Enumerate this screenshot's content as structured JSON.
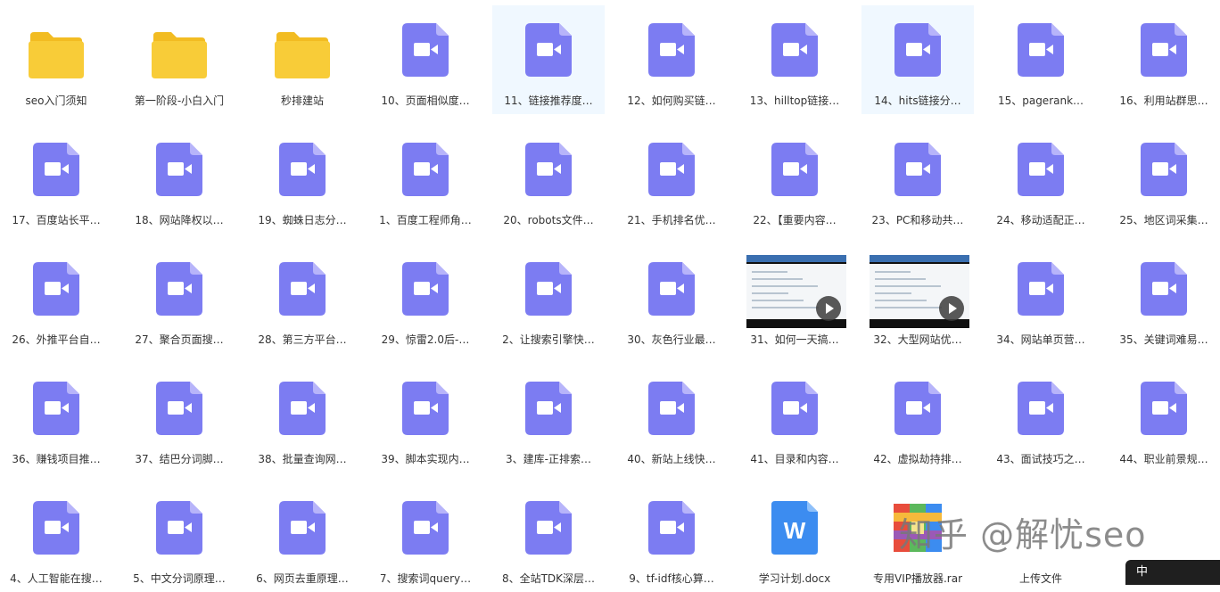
{
  "files": [
    {
      "name": "seo入门须知",
      "type": "folder"
    },
    {
      "name": "第一阶段-小白入门",
      "type": "folder"
    },
    {
      "name": "秒排建站",
      "type": "folder"
    },
    {
      "name": "10、页面相似度…",
      "type": "video"
    },
    {
      "name": "11、链接推荐度…",
      "type": "video",
      "selected": true
    },
    {
      "name": "12、如何购买链…",
      "type": "video"
    },
    {
      "name": "13、hilltop链接…",
      "type": "video"
    },
    {
      "name": "14、hits链接分…",
      "type": "video",
      "selected": true
    },
    {
      "name": "15、pagerank…",
      "type": "video"
    },
    {
      "name": "16、利用站群思…",
      "type": "video"
    },
    {
      "name": "17、百度站长平…",
      "type": "video"
    },
    {
      "name": "18、网站降权以…",
      "type": "video"
    },
    {
      "name": "19、蜘蛛日志分…",
      "type": "video"
    },
    {
      "name": "1、百度工程师角…",
      "type": "video"
    },
    {
      "name": "20、robots文件…",
      "type": "video"
    },
    {
      "name": "21、手机排名优…",
      "type": "video"
    },
    {
      "name": "22、【重要内容…",
      "type": "video"
    },
    {
      "name": "23、PC和移动共…",
      "type": "video"
    },
    {
      "name": "24、移动适配正…",
      "type": "video"
    },
    {
      "name": "25、地区词采集…",
      "type": "video"
    },
    {
      "name": "26、外推平台自…",
      "type": "video"
    },
    {
      "name": "27、聚合页面搜…",
      "type": "video"
    },
    {
      "name": "28、第三方平台…",
      "type": "video"
    },
    {
      "name": "29、惊雷2.0后-…",
      "type": "video"
    },
    {
      "name": "2、让搜索引擎快…",
      "type": "video"
    },
    {
      "name": "30、灰色行业最…",
      "type": "video"
    },
    {
      "name": "31、如何一天搞…",
      "type": "thumb"
    },
    {
      "name": "32、大型网站优…",
      "type": "thumb"
    },
    {
      "name": "34、网站单页营…",
      "type": "video"
    },
    {
      "name": "35、关键词难易…",
      "type": "video"
    },
    {
      "name": "36、赚钱项目推…",
      "type": "video"
    },
    {
      "name": "37、结巴分词脚…",
      "type": "video"
    },
    {
      "name": "38、批量查询网…",
      "type": "video"
    },
    {
      "name": "39、脚本实现内…",
      "type": "video"
    },
    {
      "name": "3、建库-正排索…",
      "type": "video"
    },
    {
      "name": "40、新站上线快…",
      "type": "video"
    },
    {
      "name": "41、目录和内容…",
      "type": "video"
    },
    {
      "name": "42、虚拟劫持排…",
      "type": "video"
    },
    {
      "name": "43、面试技巧之…",
      "type": "video"
    },
    {
      "name": "44、职业前景规…",
      "type": "video"
    },
    {
      "name": "4、人工智能在搜…",
      "type": "video"
    },
    {
      "name": "5、中文分词原理…",
      "type": "video"
    },
    {
      "name": "6、网页去重原理…",
      "type": "video"
    },
    {
      "name": "7、搜索词query…",
      "type": "video"
    },
    {
      "name": "8、全站TDK深层…",
      "type": "video"
    },
    {
      "name": "9、tf-idf核心算…",
      "type": "video"
    },
    {
      "name": "学习计划.docx",
      "type": "word"
    },
    {
      "name": "专用VIP播放器.rar",
      "type": "rar"
    },
    {
      "name": "上传文件",
      "type": "upload"
    },
    {
      "name": "",
      "type": "empty"
    }
  ],
  "watermark": "知乎 @解忧seo",
  "corner_badge": "中",
  "colors": {
    "video": "#7c7cf2",
    "video_fold": "#b7b4fa",
    "folder": "#f8cc38",
    "folder_tab": "#f2bc22",
    "word": "#3c8cf0",
    "selected_bg": "#f0f8ff"
  }
}
